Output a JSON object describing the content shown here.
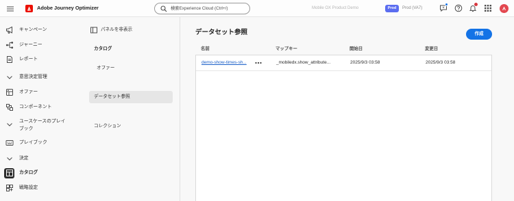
{
  "header": {
    "app_title": "Adobe Journey Optimizer",
    "search": {
      "placeholder": "検索Experience Cloud (Ctrl+/)"
    },
    "org_name": "Mobile OX Product Demo",
    "environment_badge": "Prod",
    "sandbox_name": "Prod (VA7)",
    "icons": {
      "menu": "hamburger-icon",
      "logo": "adobe-logo-icon",
      "search": "search-icon",
      "whats_new": "whats-new-icon",
      "help": "help-icon",
      "notifications": "bell-icon",
      "apps": "apps-grid-icon",
      "profile": "avatar-icon"
    }
  },
  "sidebar": {
    "items": [
      {
        "label": "キャンペーン",
        "icon": "campaign-icon"
      },
      {
        "label": "ジャーニー",
        "icon": "journey-icon"
      },
      {
        "label": "レポート",
        "icon": "report-icon"
      },
      {
        "label": "意思決定管理",
        "icon": "chevron-down-icon",
        "section": true
      },
      {
        "label": "オファー",
        "icon": "offer-icon"
      },
      {
        "label": "コンポーネント",
        "icon": "component-icon"
      },
      {
        "label": "ユースケースのプレイブック",
        "icon": "chevron-down-icon",
        "section": true
      },
      {
        "label": "プレイブック",
        "icon": "playbook-icon"
      },
      {
        "label": "決定",
        "icon": "chevron-down-icon",
        "section": true
      },
      {
        "label": "カタログ",
        "icon": "catalog-icon",
        "selected": true
      },
      {
        "label": "戦略設定",
        "icon": "strategy-icon"
      }
    ]
  },
  "subnav": {
    "hide_panel_label": "パネルを非表示",
    "hide_panel_icon": "panel-icon",
    "section_title": "カタログ",
    "items": [
      {
        "label": "オファー",
        "selected": false
      },
      {
        "label": "データセット参照",
        "selected": true
      },
      {
        "label": "コレクション",
        "selected": false
      }
    ]
  },
  "main": {
    "page_title": "データセット参照",
    "create_button_label": "作成",
    "table": {
      "columns": [
        "名前",
        "マップキー",
        "開始日",
        "変更日"
      ],
      "rows": [
        {
          "name": "demo-show-times-sh...",
          "actions_icon": "more-actions-icon",
          "map_key": "_mobiledx.show_attribute...",
          "start_date": "2025/9/3 03:58",
          "modified_date": "2025/9/3 03:58"
        }
      ]
    }
  },
  "colors": {
    "accent": "#1473e6",
    "adobe_red": "#eb1000",
    "environment_badge": "#5b6df0",
    "notification_badge": "#d7373f",
    "selected_background": "#e6e6e6"
  }
}
